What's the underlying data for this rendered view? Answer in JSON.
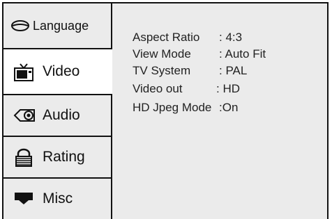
{
  "sidebar": {
    "tabs": [
      {
        "label": "Language",
        "icon": "lips-icon",
        "active": false
      },
      {
        "label": "Video",
        "icon": "tv-icon",
        "active": true
      },
      {
        "label": "Audio",
        "icon": "speaker-icon",
        "active": false
      },
      {
        "label": "Rating",
        "icon": "lock-icon",
        "active": false
      },
      {
        "label": "Misc",
        "icon": "monitor-icon",
        "active": false
      }
    ]
  },
  "settings": [
    {
      "key": "Aspect Ratio",
      "value": ": 4:3"
    },
    {
      "key": "View Mode",
      "value": ": Auto Fit"
    },
    {
      "key": "TV System",
      "value": ": PAL"
    },
    {
      "key": "Video out",
      "value": ": HD"
    },
    {
      "key": "HD Jpeg Mode",
      "value": ":On"
    }
  ]
}
